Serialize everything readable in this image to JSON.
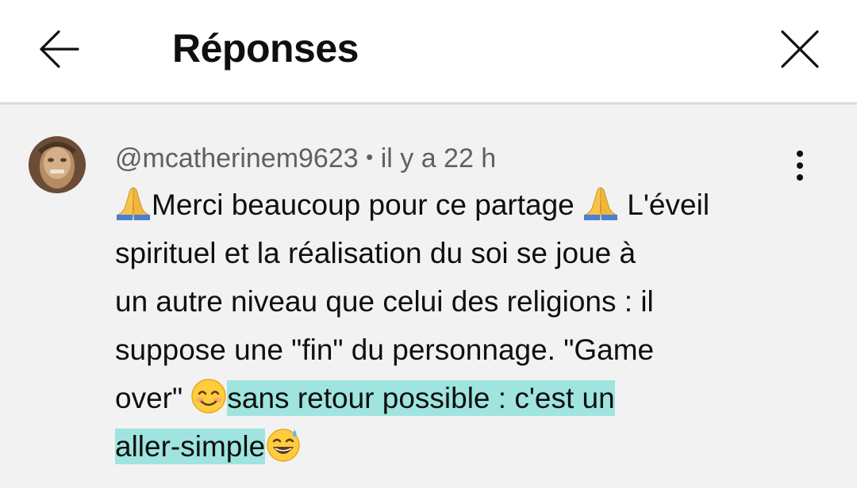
{
  "header": {
    "title": "Réponses",
    "back_icon": "arrow-left-icon",
    "close_icon": "close-icon"
  },
  "comment": {
    "author": "@mcatherinem9623",
    "separator": "•",
    "time": "il y a 22 h",
    "lines": [
      {
        "a": "Merci beaucoup pour ce partage ",
        "b": " L'éveil"
      },
      "spirituel et la réalisation du soi se joue à",
      "un autre niveau que celui des religions : il",
      "suppose une \"fin\" du personnage. \"Game",
      {
        "a": "over\" ",
        "highlight": "sans retour possible : c'est un"
      },
      {
        "highlight": "aller-simple"
      }
    ],
    "emojis": [
      "folded-hands-icon",
      "smiling-face-icon",
      "grinning-sweat-icon"
    ],
    "highlight_color": "#9fe4df",
    "menu_icon": "more-vertical-icon"
  }
}
